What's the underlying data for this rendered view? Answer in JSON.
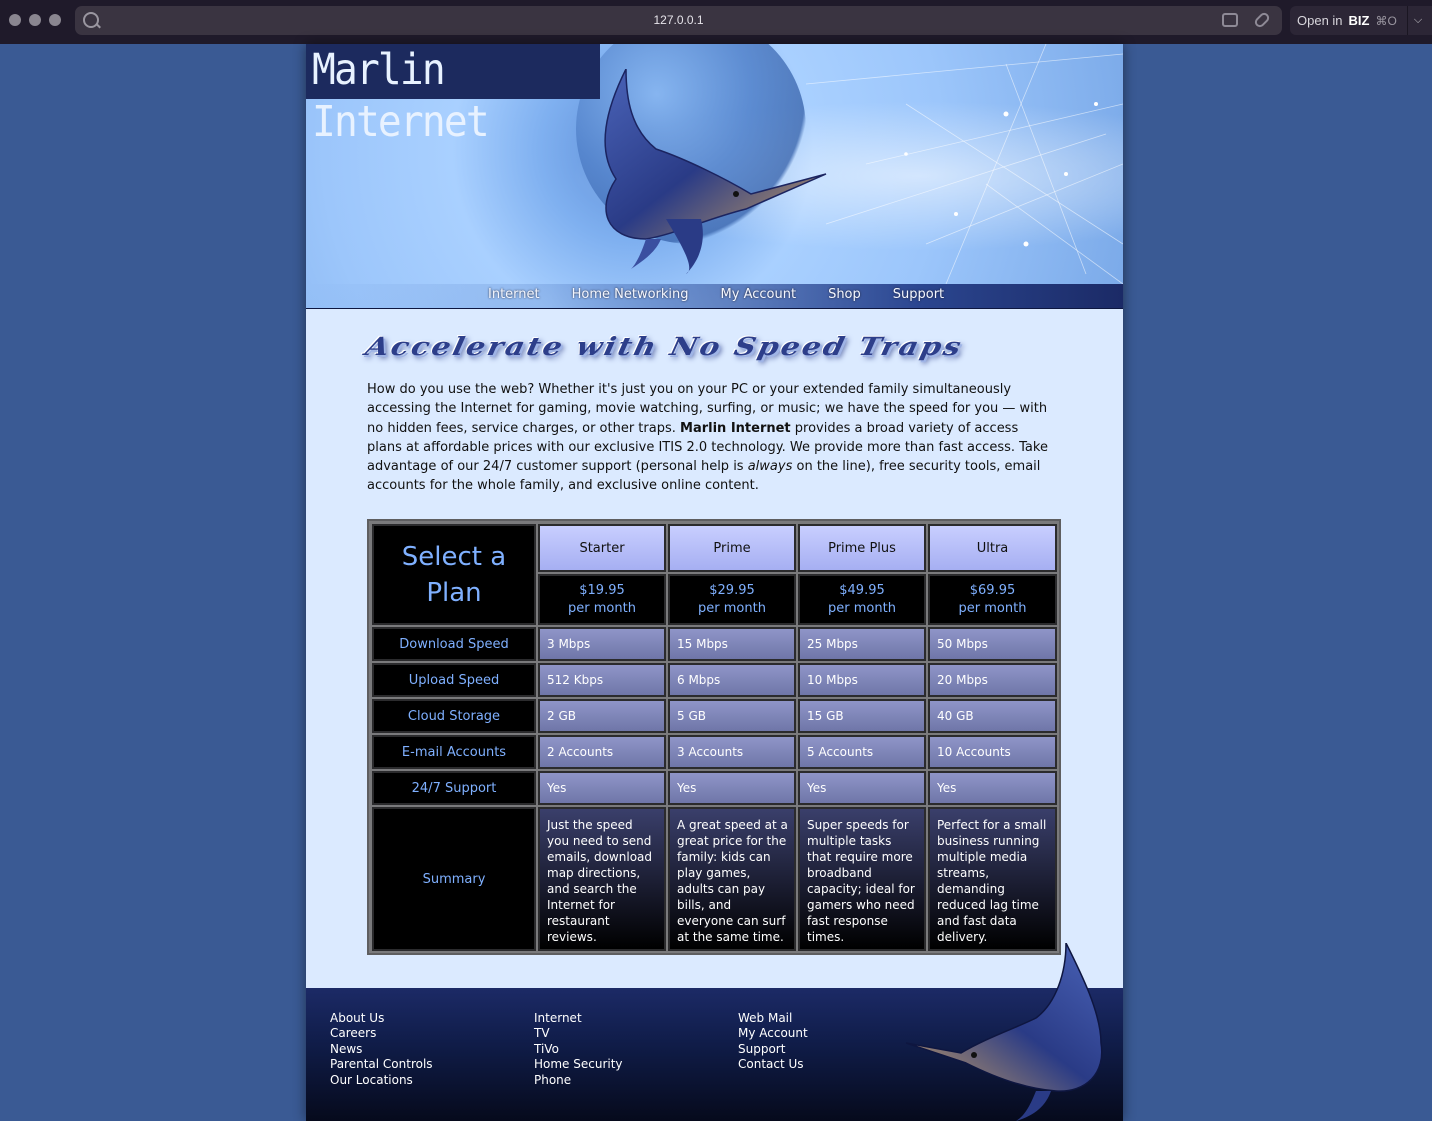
{
  "browser": {
    "url": "127.0.0.1",
    "open_in_label": "Open in",
    "open_in_app": "BIZ",
    "open_in_shortcut": "⌘O"
  },
  "banner": {
    "logo_text": "Marlin Internet"
  },
  "nav": {
    "items": [
      "Internet",
      "Home Networking",
      "My Account",
      "Shop",
      "Support"
    ]
  },
  "main": {
    "headline": "Accelerate with No Speed Traps",
    "intro_part1": "How do you use the web? Whether it's just you on your PC or your extended family simultaneously accessing the Internet for gaming, movie watching, surfing, or music; we have the speed for you — with no hidden fees, service charges, or other traps. ",
    "intro_bold": "Marlin Internet",
    "intro_part2": " provides a broad variety of access plans at affordable prices with our exclusive ITIS 2.0 technology. We provide more than fast access. Take advantage of our 24/7 customer support (personal help is ",
    "intro_italic": "always",
    "intro_part3": " on the line), free security tools, email accounts for the whole family, and exclusive online content."
  },
  "plans_table": {
    "corner_label": "Select a Plan",
    "plans": [
      {
        "name": "Starter",
        "price": "$19.95",
        "period": "per month"
      },
      {
        "name": "Prime",
        "price": "$29.95",
        "period": "per month"
      },
      {
        "name": "Prime Plus",
        "price": "$49.95",
        "period": "per month"
      },
      {
        "name": "Ultra",
        "price": "$69.95",
        "period": "per month"
      }
    ],
    "rows": [
      {
        "label": "Download Speed",
        "values": [
          "3 Mbps",
          "15 Mbps",
          "25 Mbps",
          "50 Mbps"
        ]
      },
      {
        "label": "Upload Speed",
        "values": [
          "512 Kbps",
          "6 Mbps",
          "10 Mbps",
          "20 Mbps"
        ]
      },
      {
        "label": "Cloud Storage",
        "values": [
          "2 GB",
          "5 GB",
          "15 GB",
          "40 GB"
        ]
      },
      {
        "label": "E-mail Accounts",
        "values": [
          "2 Accounts",
          "3 Accounts",
          "5 Accounts",
          "10 Accounts"
        ]
      },
      {
        "label": "24/7 Support",
        "values": [
          "Yes",
          "Yes",
          "Yes",
          "Yes"
        ]
      }
    ],
    "summary_label": "Summary",
    "summaries": [
      "Just the speed you need to send emails, download map directions, and search the Internet for restaurant reviews.",
      "A great speed at a great price for the family: kids can play games, adults can pay bills, and everyone can surf at the same time.",
      "Super speeds for multiple tasks that require more broadband capacity; ideal for gamers who need fast response times.",
      "Perfect for a small business running multiple media streams, demanding reduced lag time and fast data delivery."
    ]
  },
  "footer": {
    "col1": [
      "About Us",
      "Careers",
      "News",
      "Parental Controls",
      "Our Locations"
    ],
    "col2": [
      "Internet",
      "TV",
      "TiVo",
      "Home Security",
      "Phone"
    ],
    "col3": [
      "Web Mail",
      "My Account",
      "Support",
      "Contact Us"
    ]
  }
}
